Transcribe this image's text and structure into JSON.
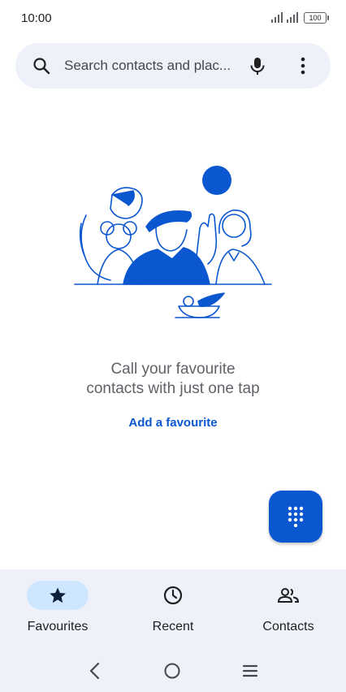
{
  "status": {
    "time": "10:00",
    "battery": "100"
  },
  "search": {
    "placeholder": "Search contacts and plac..."
  },
  "empty_state": {
    "title_line1": "Call your favourite",
    "title_line2": "contacts with just one tap",
    "action": "Add a favourite"
  },
  "nav": {
    "items": [
      {
        "label": "Favourites",
        "icon": "star-icon",
        "active": true
      },
      {
        "label": "Recent",
        "icon": "clock-icon",
        "active": false
      },
      {
        "label": "Contacts",
        "icon": "people-icon",
        "active": false
      }
    ]
  },
  "colors": {
    "accent": "#0b57d0",
    "surface": "#eef1fa",
    "active_pill": "#cfe6ff"
  }
}
